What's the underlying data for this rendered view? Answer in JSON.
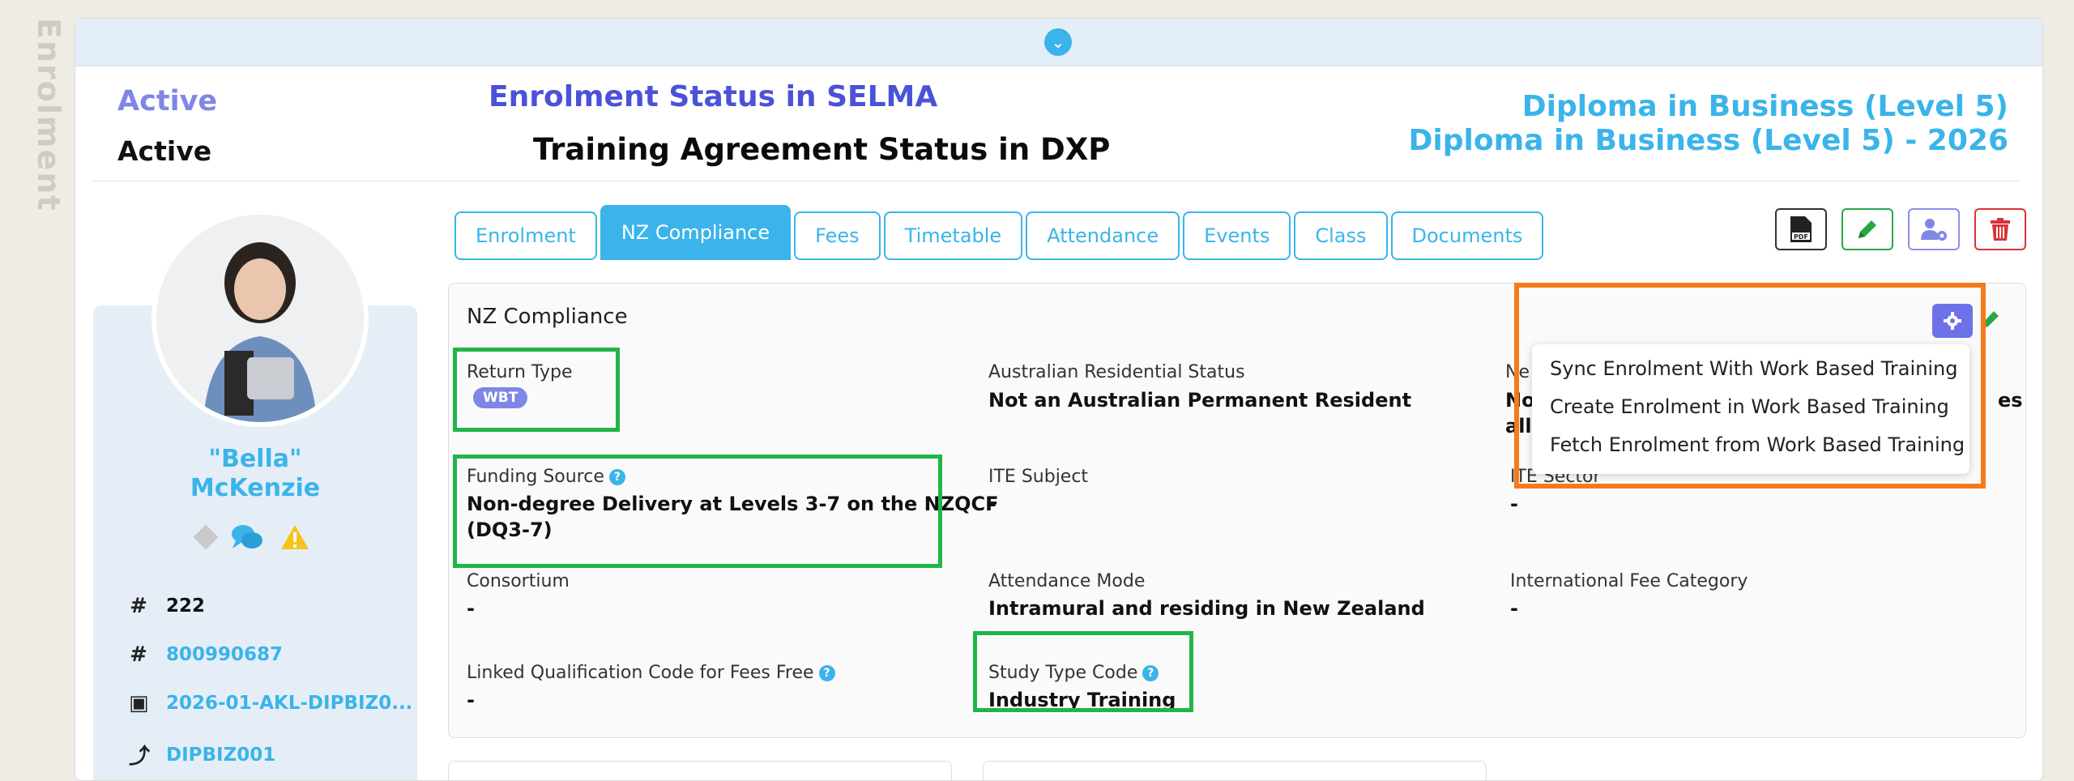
{
  "side_label": "Enrolment",
  "status": {
    "enrolment_value": "Active",
    "enrolment_desc": "Enrolment Status in SELMA",
    "training_value": "Active",
    "training_desc": "Training Agreement Status in DXP"
  },
  "course": {
    "line1": "Diploma in Business (Level 5)",
    "line2": "Diploma in Business (Level 5) - 2026"
  },
  "profile": {
    "name_first": "\"Bella\"",
    "name_last": "McKenzie",
    "rows": [
      {
        "icon": "#",
        "value": "222",
        "color": "#111"
      },
      {
        "icon": "#",
        "value": "800990687",
        "color": "#3ab4ea"
      },
      {
        "icon": "book",
        "value": "2026-01-AKL-DIPBIZ0...",
        "color": "#3ab4ea"
      },
      {
        "icon": "arrow-up",
        "value": "DIPBIZ001",
        "color": "#3ab4ea"
      }
    ]
  },
  "tabs": [
    "Enrolment",
    "NZ Compliance",
    "Fees",
    "Timetable",
    "Attendance",
    "Events",
    "Class",
    "Documents"
  ],
  "active_tab": "NZ Compliance",
  "panel": {
    "title": "NZ Compliance",
    "return_type_label": "Return Type",
    "return_type_badge": "WBT",
    "aus_res_label": "Australian Residential Status",
    "aus_res_value": "Not an Australian Permanent Resident",
    "col3_row1_label_partial": "Ne",
    "col3_row1_value_partial1": "No",
    "col3_row1_value_partial2": "all",
    "col3_row1_value_tail": "es",
    "funding_label": "Funding Source",
    "funding_value_line1": "Non-degree Delivery at Levels 3-7 on the NZQCF",
    "funding_value_line2": "(DQ3-7)",
    "ite_subject_label": "ITE Subject",
    "ite_subject_value": "-",
    "ite_sector_label": "ITE Sector",
    "ite_sector_value": "-",
    "consortium_label": "Consortium",
    "consortium_value": "-",
    "attendance_mode_label": "Attendance Mode",
    "attendance_mode_value": "Intramural and residing in New Zealand",
    "intl_fee_label": "International Fee Category",
    "intl_fee_value": "-",
    "linked_qual_label": "Linked Qualification Code for Fees Free",
    "linked_qual_value": "-",
    "study_type_label": "Study Type Code",
    "study_type_value": "Industry Training"
  },
  "dropdown": {
    "items": [
      "Sync Enrolment With Work Based Training",
      "Create Enrolment in Work Based Training",
      "Fetch Enrolment from Work Based Training"
    ]
  },
  "colors": {
    "accent": "#3ab4ea",
    "indigo": "#4b52d8",
    "green_box": "#20b548",
    "orange_box": "#f57a1b",
    "danger": "#d9343a",
    "success": "#27a844"
  }
}
